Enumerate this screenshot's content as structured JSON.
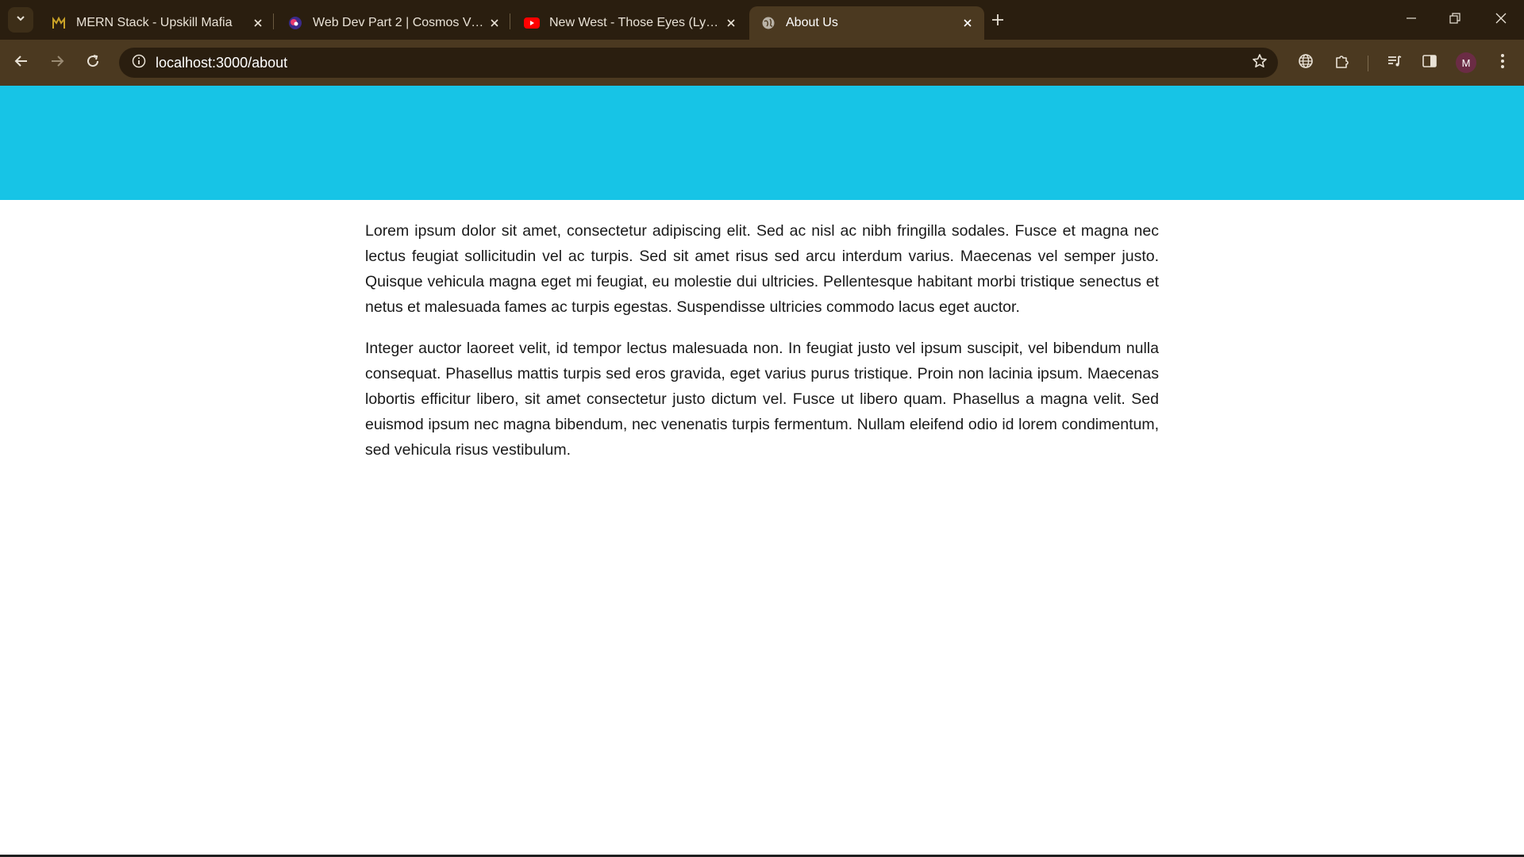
{
  "browser": {
    "tabs": [
      {
        "title": "MERN Stack - Upskill Mafia",
        "favicon": "upskill-mafia-icon",
        "active": false
      },
      {
        "title": "Web Dev Part 2 | Cosmos Video",
        "favicon": "cosmos-video-icon",
        "active": false
      },
      {
        "title": "New West - Those Eyes (Lyrics)",
        "favicon": "youtube-icon",
        "active": false
      },
      {
        "title": "About Us",
        "favicon": "globe-icon",
        "active": true
      }
    ],
    "address_bar": {
      "url": "localhost:3000/about"
    },
    "profile_initial": "M"
  },
  "page": {
    "hero_color": "#17c4e6",
    "paragraphs": [
      "Lorem ipsum dolor sit amet, consectetur adipiscing elit. Sed ac nisl ac nibh fringilla sodales. Fusce et magna nec lectus feugiat sollicitudin vel ac turpis. Sed sit amet risus sed arcu interdum varius. Maecenas vel semper justo. Quisque vehicula magna eget mi feugiat, eu molestie dui ultricies. Pellentesque habitant morbi tristique senectus et netus et malesuada fames ac turpis egestas. Suspendisse ultricies commodo lacus eget auctor.",
      "Integer auctor laoreet velit, id tempor lectus malesuada non. In feugiat justo vel ipsum suscipit, vel bibendum nulla consequat. Phasellus mattis turpis sed eros gravida, eget varius purus tristique. Proin non lacinia ipsum. Maecenas lobortis efficitur libero, sit amet consectetur justo dictum vel. Fusce ut libero quam. Phasellus a magna velit. Sed euismod ipsum nec magna bibendum, nec venenatis turpis fermentum. Nullam eleifend odio id lorem condimentum, sed vehicula risus vestibulum."
    ]
  }
}
